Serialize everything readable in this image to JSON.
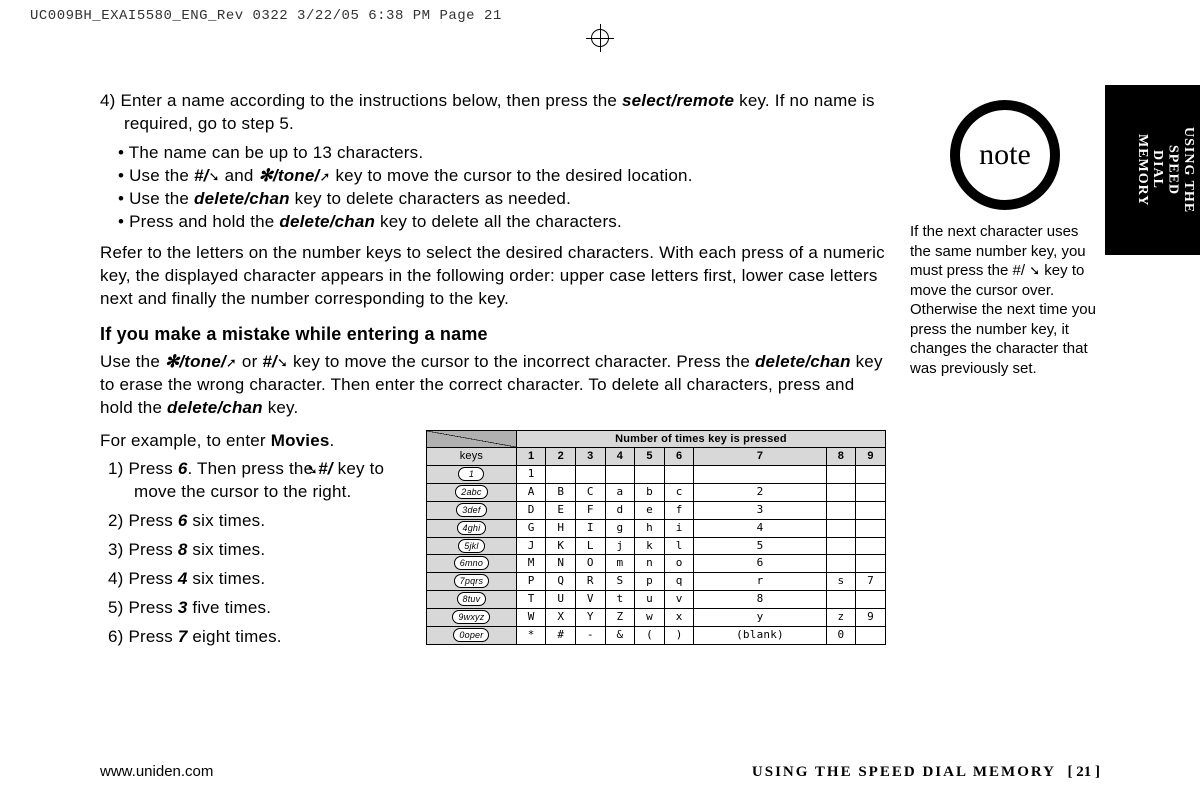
{
  "proof_line": "UC009BH_EXAI5580_ENG_Rev 0322  3/22/05  6:38 PM  Page 21",
  "tab_title": "USING THE SPEED DIAL MEMORY",
  "note_label": "note",
  "note_text": "If the next character uses the same number key, you must press the #/ ➘ key to move the cursor over. Otherwise the next time you press the number key, it changes the character that was previously set.",
  "step4_lead": "4) Enter a name according to the instructions below, then press the ",
  "step4_key": "select/remote",
  "step4_tail": " key. If no name is required, go to step 5.",
  "bul1": "The name can be up to 13 characters.",
  "bul2a": "Use the ",
  "bul2b": "#/",
  "bul2c": " and ",
  "bul2d": "/tone/",
  "bul2e": " key to move the cursor to the desired location.",
  "bul3a": "Use the ",
  "bul3b": "delete/chan",
  "bul3c": " key to delete characters as needed.",
  "bul4a": "Press and hold the ",
  "bul4b": "delete/chan",
  "bul4c": " key to delete all the characters.",
  "para2": "Refer to the letters on the number keys to select the desired characters. With each press of a numeric key, the displayed character appears in the following order: upper case letters first, lower case letters next and finally the number corresponding to the key.",
  "mistake_h": "If you make a mistake while entering a name",
  "mistake_p1": "Use the ",
  "tone_key": "/tone/",
  "mistake_or": " or ",
  "hash_key": "#/",
  "mistake_p2": " key to move the cursor to the incorrect character. Press the ",
  "delchan": "delete/chan",
  "mistake_p3": " key to erase the wrong character. Then enter the correct character. To delete all characters, press and hold the ",
  "mistake_p4": " key.",
  "example_lead": "For example, to enter ",
  "example_word": "Movies",
  "ex1a": "1) Press ",
  "k6": "6",
  "ex1b": ". Then press the ",
  "ex1c": " key to move the cursor to the right.",
  "ex2a": "2) Press ",
  "ex2b": " six times.",
  "ex3a": "3) Press ",
  "k8": "8",
  "ex3b": " six times.",
  "ex4a": "4) Press ",
  "k4": "4",
  "ex4b": " six times.",
  "ex5a": "5) Press ",
  "k3": "3",
  "ex5b": " five times.",
  "ex6a": "6) Press ",
  "k7": "7",
  "ex6b": " eight times.",
  "table": {
    "head_span": "Number of times key is pressed",
    "keys_label": "keys",
    "cols": [
      "1",
      "2",
      "3",
      "4",
      "5",
      "6",
      "7",
      "8",
      "9"
    ],
    "rows": [
      {
        "k": "1",
        "c": [
          "1",
          "",
          "",
          "",
          "",
          "",
          "",
          "",
          ""
        ]
      },
      {
        "k": "2abc",
        "c": [
          "A",
          "B",
          "C",
          "a",
          "b",
          "c",
          "2",
          "",
          ""
        ]
      },
      {
        "k": "3def",
        "c": [
          "D",
          "E",
          "F",
          "d",
          "e",
          "f",
          "3",
          "",
          ""
        ]
      },
      {
        "k": "4ghi",
        "c": [
          "G",
          "H",
          "I",
          "g",
          "h",
          "i",
          "4",
          "",
          ""
        ]
      },
      {
        "k": "5jkl",
        "c": [
          "J",
          "K",
          "L",
          "j",
          "k",
          "l",
          "5",
          "",
          ""
        ]
      },
      {
        "k": "6mno",
        "c": [
          "M",
          "N",
          "O",
          "m",
          "n",
          "o",
          "6",
          "",
          ""
        ]
      },
      {
        "k": "7pqrs",
        "c": [
          "P",
          "Q",
          "R",
          "S",
          "p",
          "q",
          "r",
          "s",
          "7"
        ]
      },
      {
        "k": "8tuv",
        "c": [
          "T",
          "U",
          "V",
          "t",
          "u",
          "v",
          "8",
          "",
          ""
        ]
      },
      {
        "k": "9wxyz",
        "c": [
          "W",
          "X",
          "Y",
          "Z",
          "w",
          "x",
          "y",
          "z",
          "9"
        ]
      },
      {
        "k": "0oper",
        "c": [
          "*",
          "#",
          "-",
          "&",
          "(",
          ")",
          "(blank)",
          "0",
          ""
        ]
      }
    ]
  },
  "footer_left": "www.uniden.com",
  "footer_right_title": "USING THE SPEED DIAL MEMORY",
  "footer_page": "[ 21 ]"
}
